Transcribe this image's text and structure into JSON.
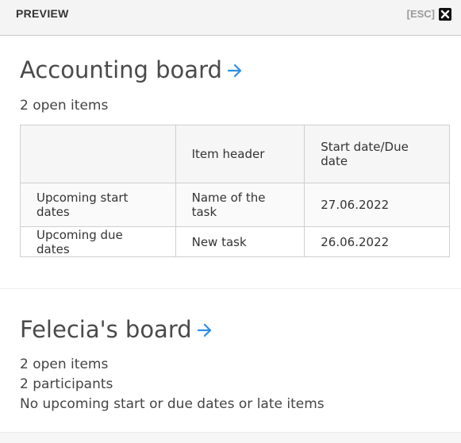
{
  "header": {
    "title": "PREVIEW",
    "esc_hint": "[ESC]",
    "close_icon": "close-icon"
  },
  "colors": {
    "accent": "#2f8fe3",
    "header_bg": "#f4f4f4",
    "text": "#3a3a3a"
  },
  "boards": [
    {
      "title": "Accounting board",
      "link_icon": "arrow-right-icon",
      "open_items": "2 open items",
      "table": {
        "headers": [
          "",
          "Item header",
          "Start date/Due date"
        ],
        "rows": [
          [
            "Upcoming start dates",
            "Name of the task",
            "27.06.2022"
          ],
          [
            "Upcoming due dates",
            "New task",
            "26.06.2022"
          ]
        ]
      }
    },
    {
      "title": "Felecia's board",
      "link_icon": "arrow-right-icon",
      "open_items": "2 open items",
      "participants": "2 participants",
      "note": "No upcoming start or due dates or late items"
    }
  ]
}
